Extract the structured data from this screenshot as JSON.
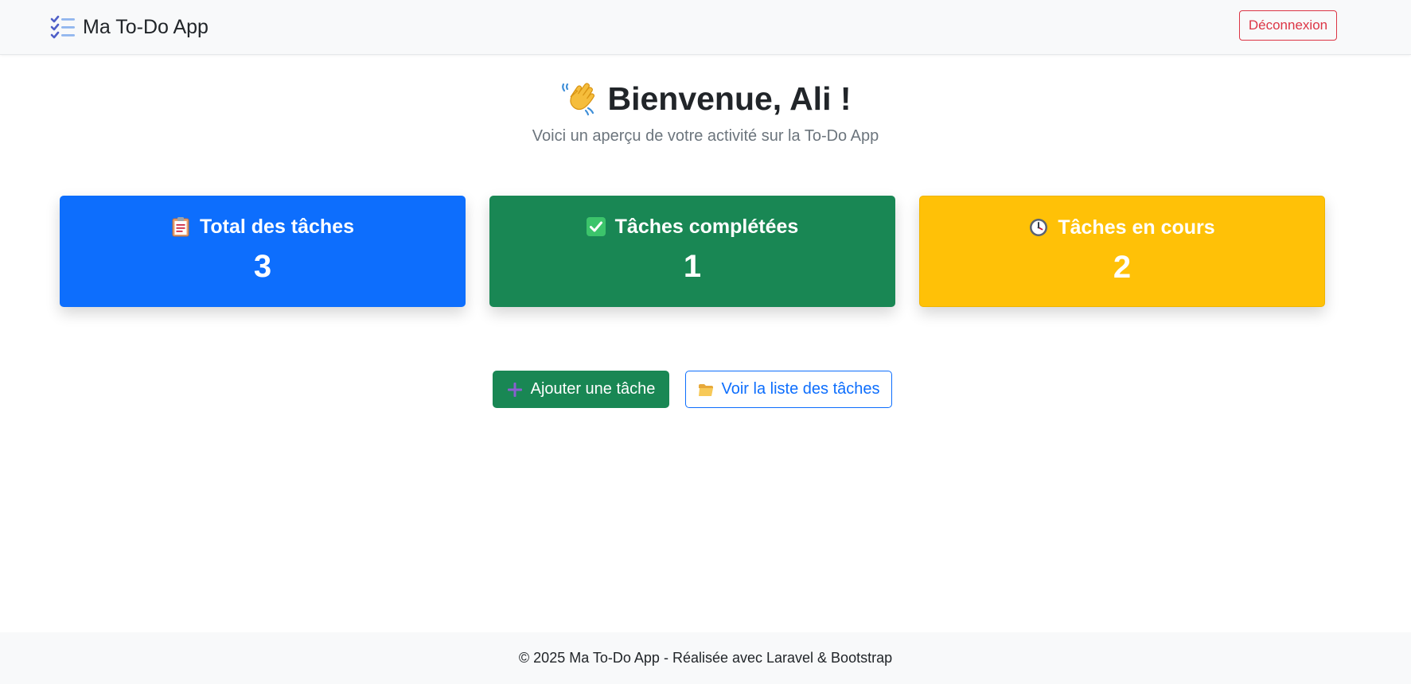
{
  "navbar": {
    "brand_name": "Ma To-Do App",
    "brand_icon": "checklist-icon",
    "logout_label": "Déconnexion"
  },
  "hero": {
    "title": "Bienvenue, Ali !",
    "title_icon": "waving-hand-icon",
    "subtitle": "Voici un aperçu de votre activité sur la To-Do App"
  },
  "stats": [
    {
      "label": "Total des tâches",
      "value": "3",
      "icon": "clipboard-icon",
      "color": "#0d6efd"
    },
    {
      "label": "Tâches complétées",
      "value": "1",
      "icon": "check-mark-icon",
      "color": "#198754"
    },
    {
      "label": "Tâches en cours",
      "value": "2",
      "icon": "clock-icon",
      "color": "#ffc107"
    }
  ],
  "actions": {
    "add_label": "Ajouter une tâche",
    "add_icon": "plus-icon",
    "list_label": "Voir la liste des tâches",
    "list_icon": "folder-icon"
  },
  "footer": {
    "text": "© 2025 Ma To-Do App - Réalisée avec Laravel & Bootstrap"
  },
  "colors": {
    "primary": "#0d6efd",
    "success": "#198754",
    "warning": "#ffc107",
    "danger": "#dc3545",
    "muted": "#6c757d"
  }
}
